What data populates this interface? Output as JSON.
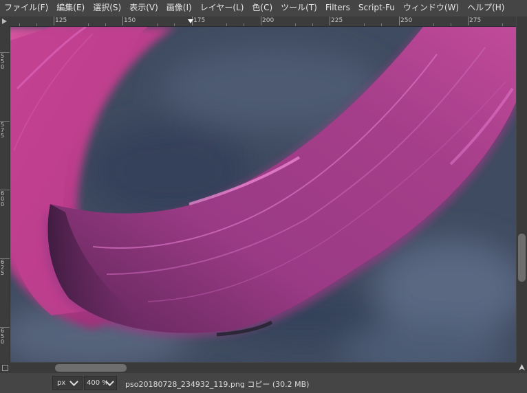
{
  "menubar": {
    "items": [
      "ファイル(F)",
      "編集(E)",
      "選択(S)",
      "表示(V)",
      "画像(I)",
      "レイヤー(L)",
      "色(C)",
      "ツール(T)",
      "Filters",
      "Script-Fu",
      "ウィンドウ(W)",
      "ヘルプ(H)"
    ]
  },
  "ruler": {
    "top_labels": [
      "125",
      "150",
      "175",
      "200",
      "225",
      "250",
      "275"
    ],
    "left_labels": [
      "550",
      "575",
      "600",
      "625",
      "650"
    ]
  },
  "statusbar": {
    "unit": "px",
    "zoom": "400 %",
    "filename": "pso20180728_234932_119.png コピー (30.2 MB)"
  },
  "colors": {
    "ui_bg": "#454545",
    "canvas_bg": "#3d4a5e",
    "hair_magenta": "#b03f8c",
    "hair_highlight": "#e06ac4"
  },
  "icons": {
    "corner": "triangle-right-icon",
    "navigate": "navigate-arrow-icon",
    "quick_mask": "quick-mask-icon"
  }
}
